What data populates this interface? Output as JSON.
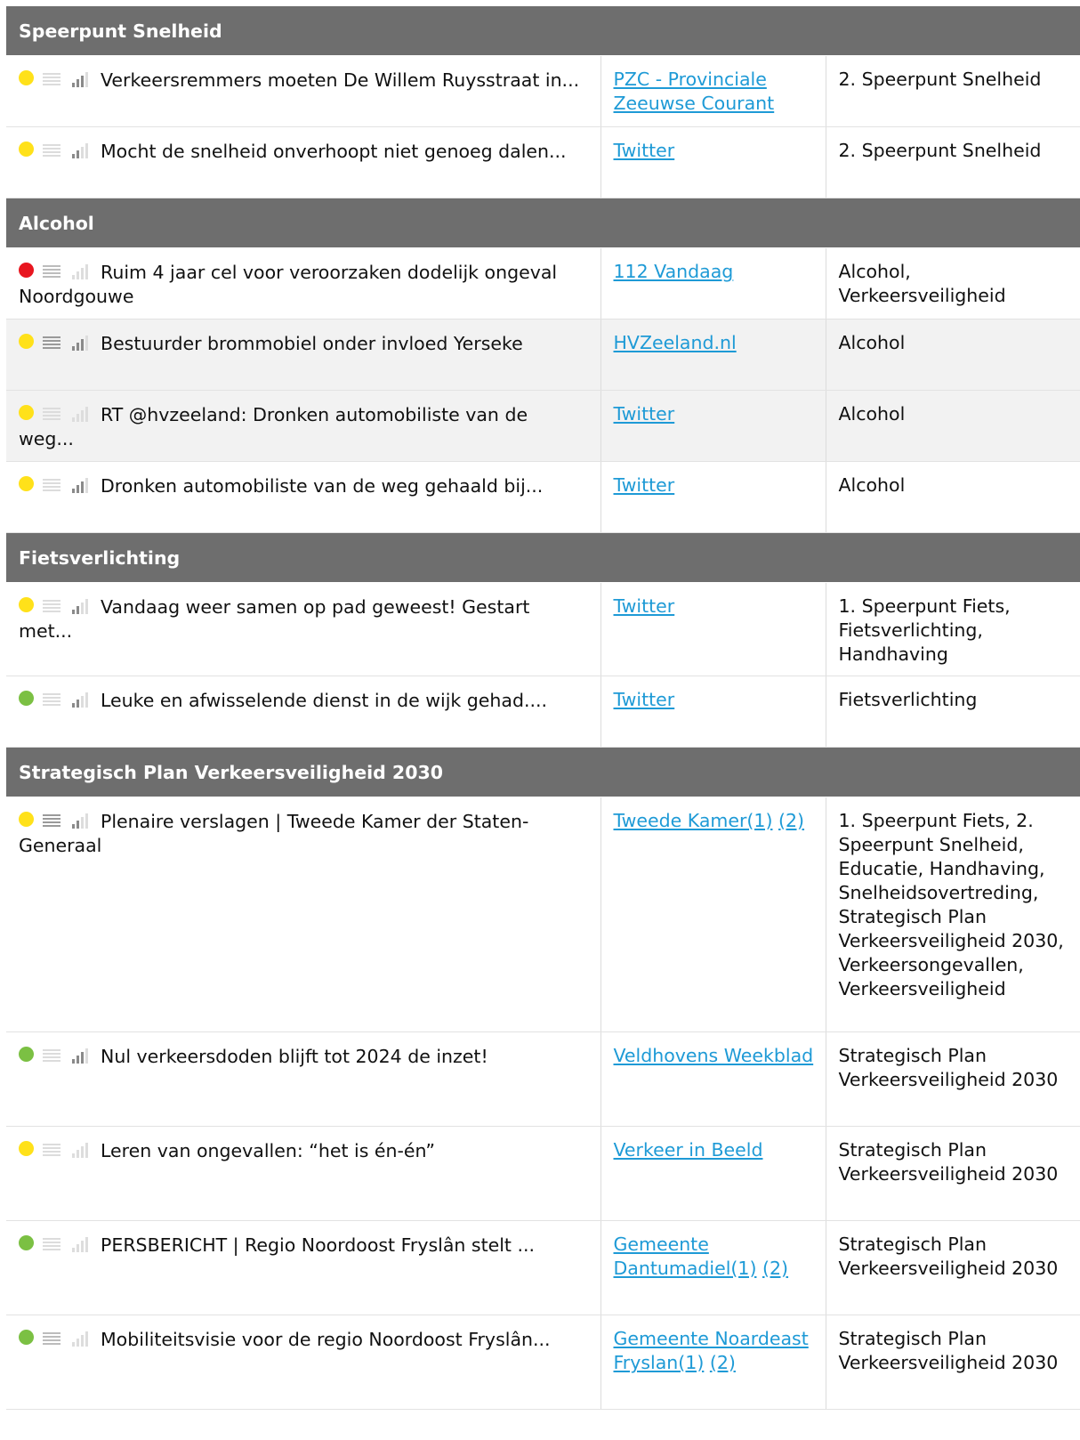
{
  "sections": [
    {
      "title": "Speerpunt Snelheid",
      "rows": [
        {
          "status": "yellow",
          "lines": "light",
          "bars": 3,
          "text": "Verkeersremmers moeten De Willem Ruysstraat in...",
          "sources": [
            {
              "label": "PZC - Provinciale Zeeuwse Courant"
            }
          ],
          "tags": "2. Speerpunt Snelheid",
          "shade": false,
          "height": 80
        },
        {
          "status": "yellow",
          "lines": "light",
          "bars": 2,
          "text": "Mocht de snelheid onverhoopt niet genoeg dalen...",
          "sources": [
            {
              "label": "Twitter"
            }
          ],
          "tags": "2. Speerpunt Snelheid",
          "shade": false,
          "height": 80
        }
      ]
    },
    {
      "title": "Alcohol",
      "rows": [
        {
          "status": "red",
          "lines": "medium",
          "bars": 0,
          "text": "Ruim 4 jaar cel voor veroorzaken dodelijk ongeval Noordgouwe",
          "sources": [
            {
              "label": "112 Vandaag"
            }
          ],
          "tags": "Alcohol, Verkeersveiligheid",
          "shade": false,
          "height": 80
        },
        {
          "status": "yellow",
          "lines": "dark",
          "bars": 3,
          "text": "Bestuurder brommobiel onder invloed Yerseke",
          "sources": [
            {
              "label": "HVZeeland.nl"
            }
          ],
          "tags": "Alcohol",
          "shade": true,
          "height": 80
        },
        {
          "status": "yellow",
          "lines": "light",
          "bars": 0,
          "text": "RT @hvzeeland: Dronken automobiliste van de weg...",
          "sources": [
            {
              "label": "Twitter"
            }
          ],
          "tags": "Alcohol",
          "shade": true,
          "height": 80
        },
        {
          "status": "yellow",
          "lines": "light",
          "bars": 3,
          "text": "Dronken automobiliste van de weg gehaald bij...",
          "sources": [
            {
              "label": "Twitter"
            }
          ],
          "tags": "Alcohol",
          "shade": false,
          "height": 80
        }
      ]
    },
    {
      "title": "Fietsverlichting",
      "rows": [
        {
          "status": "yellow",
          "lines": "light",
          "bars": 2,
          "text": "Vandaag weer samen op pad geweest! Gestart met...",
          "sources": [
            {
              "label": "Twitter"
            }
          ],
          "tags": "1. Speerpunt Fiets, Fietsverlichting, Handhaving",
          "shade": false,
          "height": 105
        },
        {
          "status": "green",
          "lines": "light",
          "bars": 2,
          "text": "Leuke en afwisselende dienst in de wijk gehad....",
          "sources": [
            {
              "label": "Twitter"
            }
          ],
          "tags": "Fietsverlichting",
          "shade": false,
          "height": 80
        }
      ]
    },
    {
      "title": "Strategisch Plan Verkeersveiligheid 2030",
      "rows": [
        {
          "status": "yellow",
          "lines": "dark",
          "bars": 2,
          "text": "Plenaire verslagen | Tweede Kamer der Staten-Generaal",
          "sources": [
            {
              "label": "Tweede Kamer(1)"
            },
            {
              "label": "(2)"
            }
          ],
          "tags": "1. Speerpunt Fiets, 2. Speerpunt Snelheid, Educatie, Handhaving, Snelheidsovertreding, Strategisch Plan Verkeersveiligheid 2030, Verkeersongevallen, Verkeersveiligheid",
          "shade": false,
          "height": 264
        },
        {
          "status": "green",
          "lines": "light",
          "bars": 3,
          "text": "Nul verkeersdoden blijft tot 2024 de inzet!",
          "sources": [
            {
              "label": "Veldhovens Weekblad"
            }
          ],
          "tags": "Strategisch Plan Verkeersveiligheid 2030",
          "shade": false,
          "height": 106
        },
        {
          "status": "yellow",
          "lines": "light",
          "bars": 0,
          "text": "Leren van ongevallen: “het is én-én”",
          "sources": [
            {
              "label": "Verkeer in Beeld"
            }
          ],
          "tags": "Strategisch Plan Verkeersveiligheid 2030",
          "shade": false,
          "height": 106
        },
        {
          "status": "green",
          "lines": "light",
          "bars": 0,
          "text": "PERSBERICHT | Regio Noordoost Fryslân stelt ...",
          "sources": [
            {
              "label": "Gemeente Dantumadiel(1)"
            },
            {
              "label": "(2)"
            }
          ],
          "tags": "Strategisch Plan Verkeersveiligheid 2030",
          "shade": false,
          "height": 106
        },
        {
          "status": "green",
          "lines": "medium",
          "bars": 0,
          "text": "Mobiliteitsvisie voor de regio Noordoost Fryslân...",
          "sources": [
            {
              "label": "Gemeente Noardeast Fryslan(1)"
            },
            {
              "label": "(2)"
            }
          ],
          "tags": "Strategisch Plan Verkeersveiligheid 2030",
          "shade": false,
          "height": 106
        }
      ]
    }
  ],
  "colors": {
    "yellow": "#ffe11a",
    "red": "#e8161f",
    "green": "#7bc043",
    "link": "#1e9ad6",
    "section_bg": "#6e6e6e"
  }
}
